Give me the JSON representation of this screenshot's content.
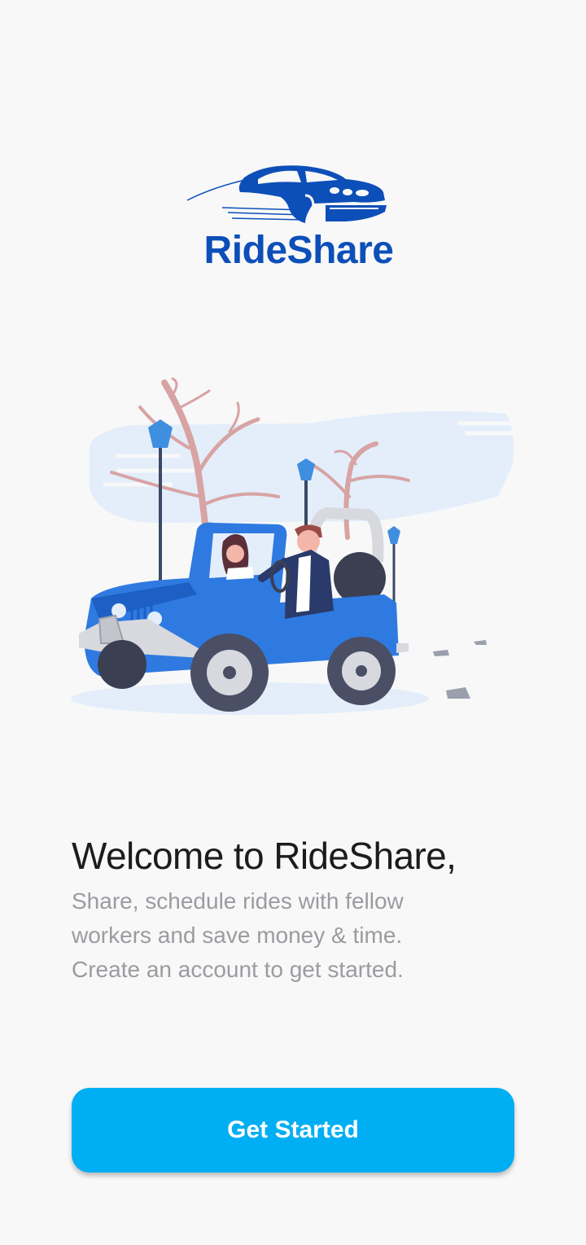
{
  "brand": {
    "name": "RideShare",
    "color": "#0d4fb8"
  },
  "welcome": {
    "title": "Welcome to RideShare,",
    "lines": [
      "Share, schedule rides with fellow",
      "workers and save money & time.",
      "Create an account to get started."
    ]
  },
  "cta": {
    "label": "Get Started",
    "color": "#00aef3"
  },
  "icons": {
    "logo": "car-logo-icon",
    "hero": "jeep-illustration"
  }
}
